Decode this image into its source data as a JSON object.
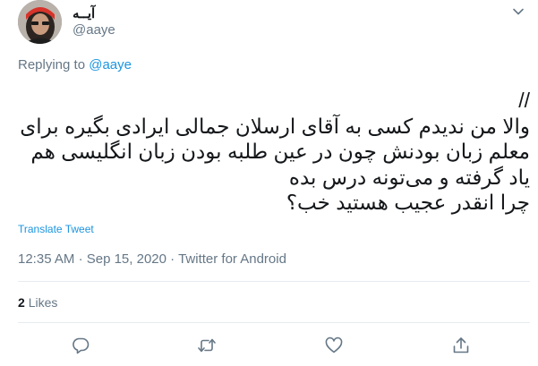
{
  "author": {
    "display_name": "آیــه",
    "handle": "@aaye"
  },
  "reply": {
    "prefix": "Replying to",
    "handle": "@aaye"
  },
  "tweet": {
    "lines": [
      "//",
      "والا من ندیدم کسی به آقای ارسلان جمالی ایرادی بگیره برای",
      "معلم زبان بودنش چون در عین طلبه بودن زبان انگلیسی هم",
      "یاد گرفته و می‌تونه درس بده",
      "چرا انقدر عجیب هستید خب؟"
    ]
  },
  "translate_label": "Translate Tweet",
  "meta": {
    "time": "12:35 AM",
    "separator": "·",
    "date": "Sep 15, 2020",
    "source": "Twitter for Android"
  },
  "stats": {
    "likes_count": "2",
    "likes_label": "Likes"
  },
  "actions": [
    "reply-icon",
    "retweet-icon",
    "like-icon",
    "share-icon"
  ],
  "colors": {
    "link": "#1b95e0",
    "secondary": "#657786",
    "text": "#14171a",
    "divider": "#e6ecf0"
  }
}
